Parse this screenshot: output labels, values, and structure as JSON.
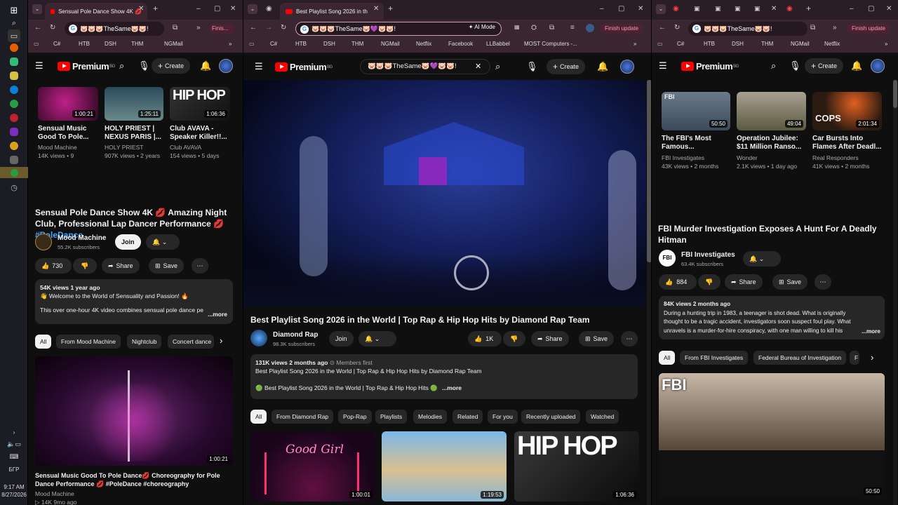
{
  "taskbar": {
    "lang": "БГР",
    "time": "9:17 AM",
    "date": "8/27/2026"
  },
  "left": {
    "tab_title": "Sensual Pole Dance Show 4K 💋",
    "omnibox": "🐷🐷🐷TheSame🐷🐷!",
    "finish_label": "Finis...",
    "bookmarks": [
      "C#",
      "HTB",
      "DSH",
      "THM",
      "NGMail"
    ],
    "yt_logo": "Premium",
    "region": "BG",
    "create": "Create",
    "thumbs": [
      {
        "title": "Sensual Music Good To Pole...",
        "channel": "Mood Machine",
        "meta": "14K views • 9",
        "dur": "1:00:21"
      },
      {
        "title": "HOLY PRIEST | NEXUS PARIS |...",
        "channel": "HOLY PRIEST",
        "meta": "907K views • 2 years",
        "dur": "1:25:11"
      },
      {
        "title": "Club AVAVA - Speaker Killer!!...",
        "channel": "Club AVAVA",
        "meta": "154 views • 5 days",
        "dur": "1:06:36"
      }
    ],
    "video_title_a": "Sensual Pole Dance Show 4K 💋 Amazing Night Club, Professional Lap Dancer Performance 💋 ",
    "video_hashtag": "#PoleDance",
    "channel": "Mood Machine",
    "subs": "55.2K subscribers",
    "join": "Join",
    "likes": "730",
    "share": "Share",
    "save": "Save",
    "views": "54K views  1 year ago",
    "desc1": "👋 Welcome to the World of Sensuality and Passion! 🔥",
    "desc2": "This over one-hour 4K video combines sensual pole dance pe",
    "more": "...more",
    "chips": [
      "All",
      "From Mood Machine",
      "Nightclub",
      "Concert dance"
    ],
    "rec_title": "Sensual Music Good To Pole Dance💋 Choreography for Pole Dance Performance 💋 #PoleDance #choreography",
    "rec_channel": "Mood Machine",
    "rec_meta": "▷ 14K  9mo ago",
    "rec_dur": "1:00:21"
  },
  "middle": {
    "tab_title": "Best Playlist Song 2026 in th",
    "omnibox": "🐷🐷🐷TheSame🐷💜🐷🐷!",
    "ai_mode": "AI Mode",
    "finish_label": "Finish update",
    "bookmarks": [
      "C#",
      "HTB",
      "DSH",
      "THM",
      "NGMail",
      "Netflix",
      "Facebook",
      "LLBabbel",
      "MOST Computers -..."
    ],
    "yt_logo": "Premium",
    "region": "BG",
    "search_value": "🐷🐷🐷TheSame🐷💜🐷🐷!",
    "create": "Create",
    "video_title": "Best Playlist Song 2026 in the World | Top Rap & Hip Hop Hits by Diamond Rap Team",
    "channel": "Diamond Rap",
    "subs": "98.3K subscribers",
    "join": "Join",
    "likes": "1K",
    "share": "Share",
    "save": "Save",
    "views": "131K views  2 months ago",
    "members": "⊙ Members first",
    "desc1": "Best Playlist Song 2026 in the World | Top Rap & Hip Hop Hits by Diamond Rap Team",
    "desc2": "🟢 Best Playlist Song 2026 in the World | Top Rap & Hip Hop Hits 🟢",
    "more": "...more",
    "chips": [
      "All",
      "From Diamond Rap",
      "Pop-Rap",
      "Playlists",
      "Melodies",
      "Related",
      "For you",
      "Recently uploaded",
      "Watched"
    ],
    "rec": [
      {
        "dur": "1:00:01",
        "label": "Good Girl"
      },
      {
        "dur": "1:19:53",
        "label": ""
      },
      {
        "dur": "1:06:36",
        "label": "HIP HOP"
      }
    ]
  },
  "right": {
    "omnibox": "🐷🐷🐷TheSame🐷🐷!",
    "finish_label": "Finish update",
    "bookmarks": [
      "C#",
      "HTB",
      "DSH",
      "THM",
      "NGMail",
      "Netflix"
    ],
    "yt_logo": "Premium",
    "region": "BG",
    "create": "Create",
    "thumbs": [
      {
        "title": "The FBI's Most Famous...",
        "channel": "FBI Investigates",
        "meta": "43K views • 2 months",
        "dur": "50:50",
        "label": "FBI"
      },
      {
        "title": "Operation Jubilee: $11 Million Ranso...",
        "channel": "Wonder",
        "meta": "2.1K views • 1 day ago",
        "dur": "49:04",
        "label": ""
      },
      {
        "title": "Car Bursts Into Flames After Deadl...",
        "channel": "Real Responders",
        "meta": "41K views • 2 months",
        "dur": "2:01:34",
        "label": "COPS"
      }
    ],
    "video_title": "FBI Murder Investigation Exposes A Hunt For A Deadly Hitman",
    "channel": "FBI Investigates",
    "subs": "63.4K subscribers",
    "likes": "884",
    "share": "Share",
    "save": "Save",
    "views": "84K views  2 months ago",
    "desc": "During a hunting trip in 1983, a teenager is shot dead. What is originally thought to be a tragic accident, investigators soon suspect foul play. What unravels is a murder-for-hire conspiracy, with one man willing to kill his friends for pr",
    "more": "...more",
    "chips": [
      "All",
      "From FBI Investigates",
      "Federal Bureau of Investigation",
      "F"
    ],
    "rec_dur": "50:50",
    "rec_label": "FBI"
  }
}
